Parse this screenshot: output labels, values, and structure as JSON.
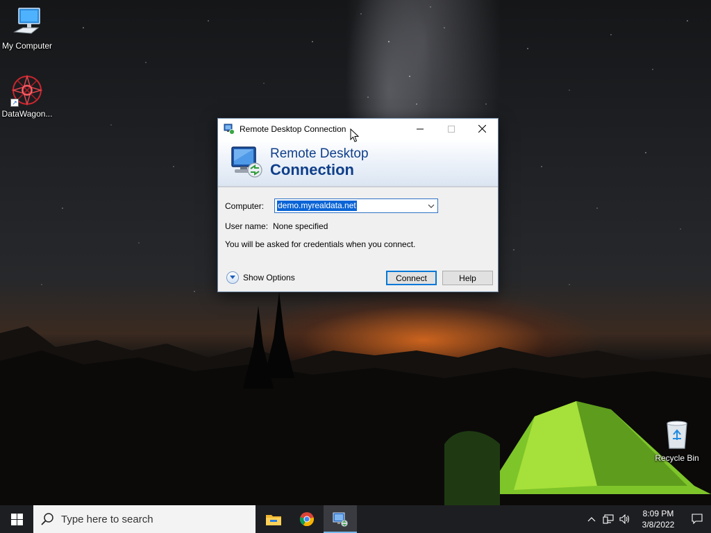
{
  "desktop": {
    "icons": [
      {
        "label": "My Computer",
        "icon": "computer-icon"
      },
      {
        "label": "DataWagon...",
        "icon": "datawagon-icon"
      },
      {
        "label": "Recycle Bin",
        "icon": "recycle-bin-icon"
      }
    ]
  },
  "dialog": {
    "title": "Remote Desktop Connection",
    "banner_line1": "Remote Desktop",
    "banner_line2": "Connection",
    "computer_label": "Computer:",
    "computer_value": "demo.myrealdata.net",
    "username_label": "User name:",
    "username_value": "None specified",
    "credentials_note": "You will be asked for credentials when you connect.",
    "show_options": "Show Options",
    "connect_button": "Connect",
    "help_button": "Help"
  },
  "taskbar": {
    "search_placeholder": "Type here to search",
    "apps": [
      "file-explorer-icon",
      "chrome-icon",
      "remote-desktop-icon"
    ],
    "time": "8:09 PM",
    "date": "3/8/2022"
  },
  "colors": {
    "accent": "#0078d7",
    "banner_text": "#0f3f8a",
    "selection": "#0a64d6",
    "taskbar": "#1d1e22"
  }
}
